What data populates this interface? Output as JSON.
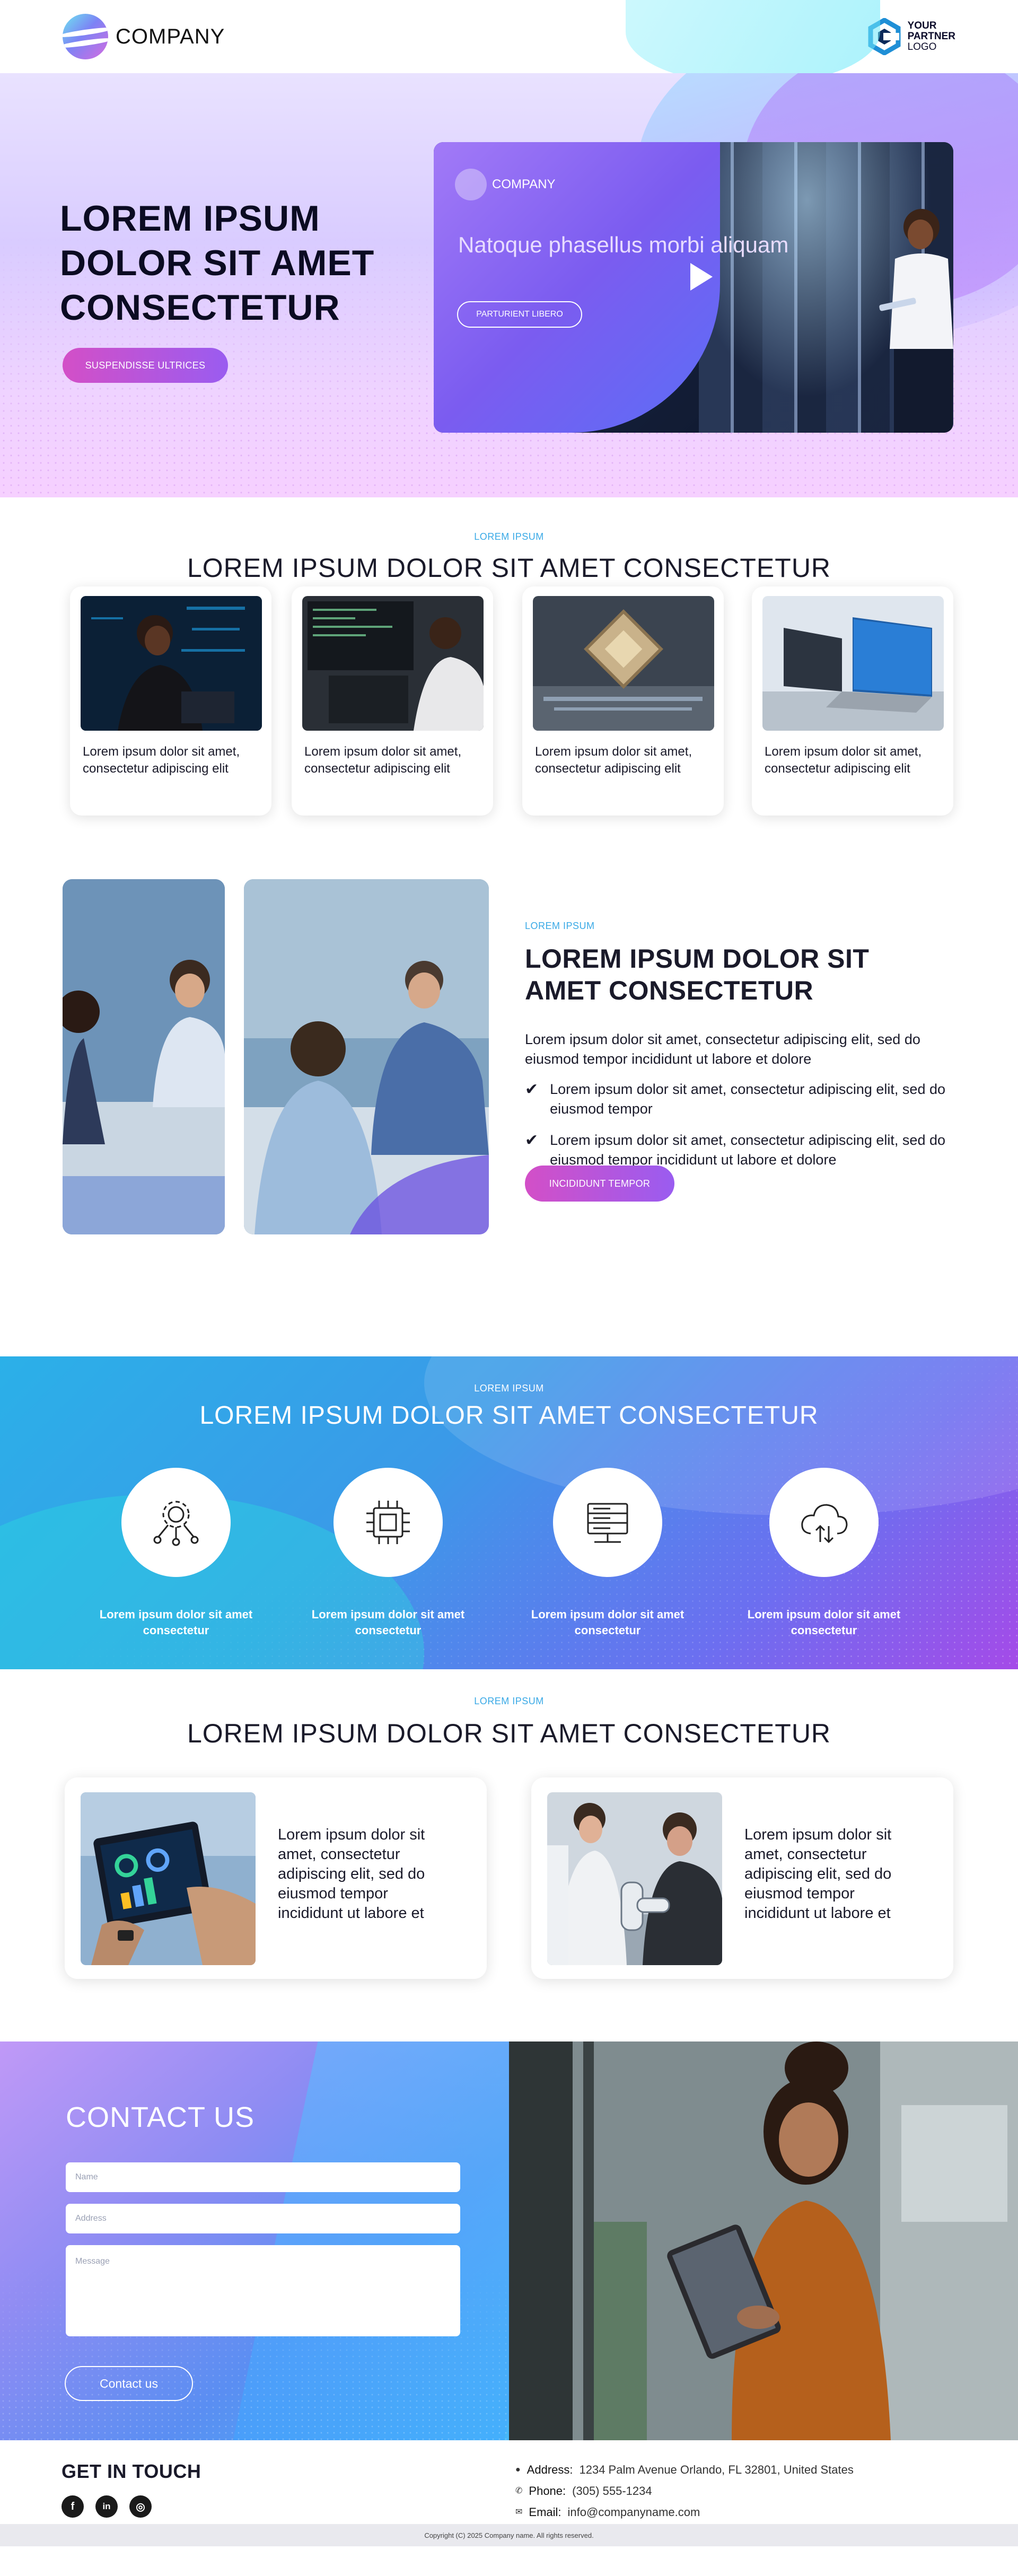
{
  "header": {
    "company": "COMPANY",
    "partner_line1": "YOUR",
    "partner_line2": "PARTNER",
    "partner_line3": "LOGO"
  },
  "hero": {
    "title": "LOREM IPSUM DOLOR SIT AMET CONSECTETUR",
    "button": "SUSPENDISSE ULTRICES",
    "video": {
      "logo_text": "COMPANY",
      "title": "Natoque phasellus morbi aliquam",
      "button": "PARTURIENT LIBERO"
    }
  },
  "cards_section": {
    "eyebrow": "LOREM IPSUM",
    "title": "LOREM IPSUM DOLOR SIT AMET CONSECTETUR",
    "cards": [
      {
        "text": "Lorem ipsum dolor sit amet, consectetur adipiscing elit"
      },
      {
        "text": "Lorem ipsum dolor sit amet, consectetur adipiscing elit"
      },
      {
        "text": "Lorem ipsum dolor sit amet, consectetur adipiscing elit"
      },
      {
        "text": "Lorem ipsum dolor sit amet, consectetur adipiscing elit"
      }
    ]
  },
  "about": {
    "eyebrow": "LOREM IPSUM",
    "title": "LOREM IPSUM DOLOR SIT AMET CONSECTETUR",
    "body": "Lorem ipsum dolor sit amet, consectetur adipiscing elit, sed do eiusmod tempor incididunt ut labore et dolore",
    "checks": [
      "Lorem ipsum dolor sit amet, consectetur adipiscing elit, sed do eiusmod tempor",
      "Lorem ipsum dolor sit amet, consectetur adipiscing elit, sed do eiusmod tempor incididunt ut labore et dolore"
    ],
    "button": "INCIDIDUNT TEMPOR"
  },
  "services": {
    "eyebrow": "LOREM IPSUM",
    "title": "LOREM IPSUM DOLOR SIT AMET CONSECTETUR",
    "items": [
      {
        "label": "Lorem ipsum dolor sit amet consectetur",
        "icon": "gear-network-icon"
      },
      {
        "label": "Lorem ipsum dolor sit amet consectetur",
        "icon": "chip-icon"
      },
      {
        "label": "Lorem ipsum dolor sit amet consectetur",
        "icon": "server-icon"
      },
      {
        "label": "Lorem ipsum dolor sit amet consectetur",
        "icon": "cloud-sync-icon"
      }
    ]
  },
  "features": {
    "eyebrow": "LOREM IPSUM",
    "title": "LOREM IPSUM DOLOR SIT AMET CONSECTETUR",
    "items": [
      {
        "text": "Lorem ipsum dolor sit amet, consectetur adipiscing elit, sed do eiusmod tempor incididunt ut labore et"
      },
      {
        "text": "Lorem ipsum dolor sit amet, consectetur adipiscing elit, sed do eiusmod tempor incididunt ut labore et"
      }
    ]
  },
  "contact": {
    "title": "CONTACT US",
    "name_placeholder": "Name",
    "address_placeholder": "Address",
    "message_placeholder": "Message",
    "button": "Contact us"
  },
  "footer": {
    "get_in_touch": "GET IN TOUCH",
    "address_label": "Address:",
    "address_value": "1234 Palm Avenue  Orlando, FL 32801,  United States",
    "phone_label": "Phone:",
    "phone_value": "(305) 555-1234",
    "email_label": "Email:",
    "email_value": "info@companyname.com",
    "social_1": "f",
    "social_2": "in",
    "social_3": "◎",
    "copyright": "Copyright (C) 2025 Company name. All rights reserved."
  }
}
